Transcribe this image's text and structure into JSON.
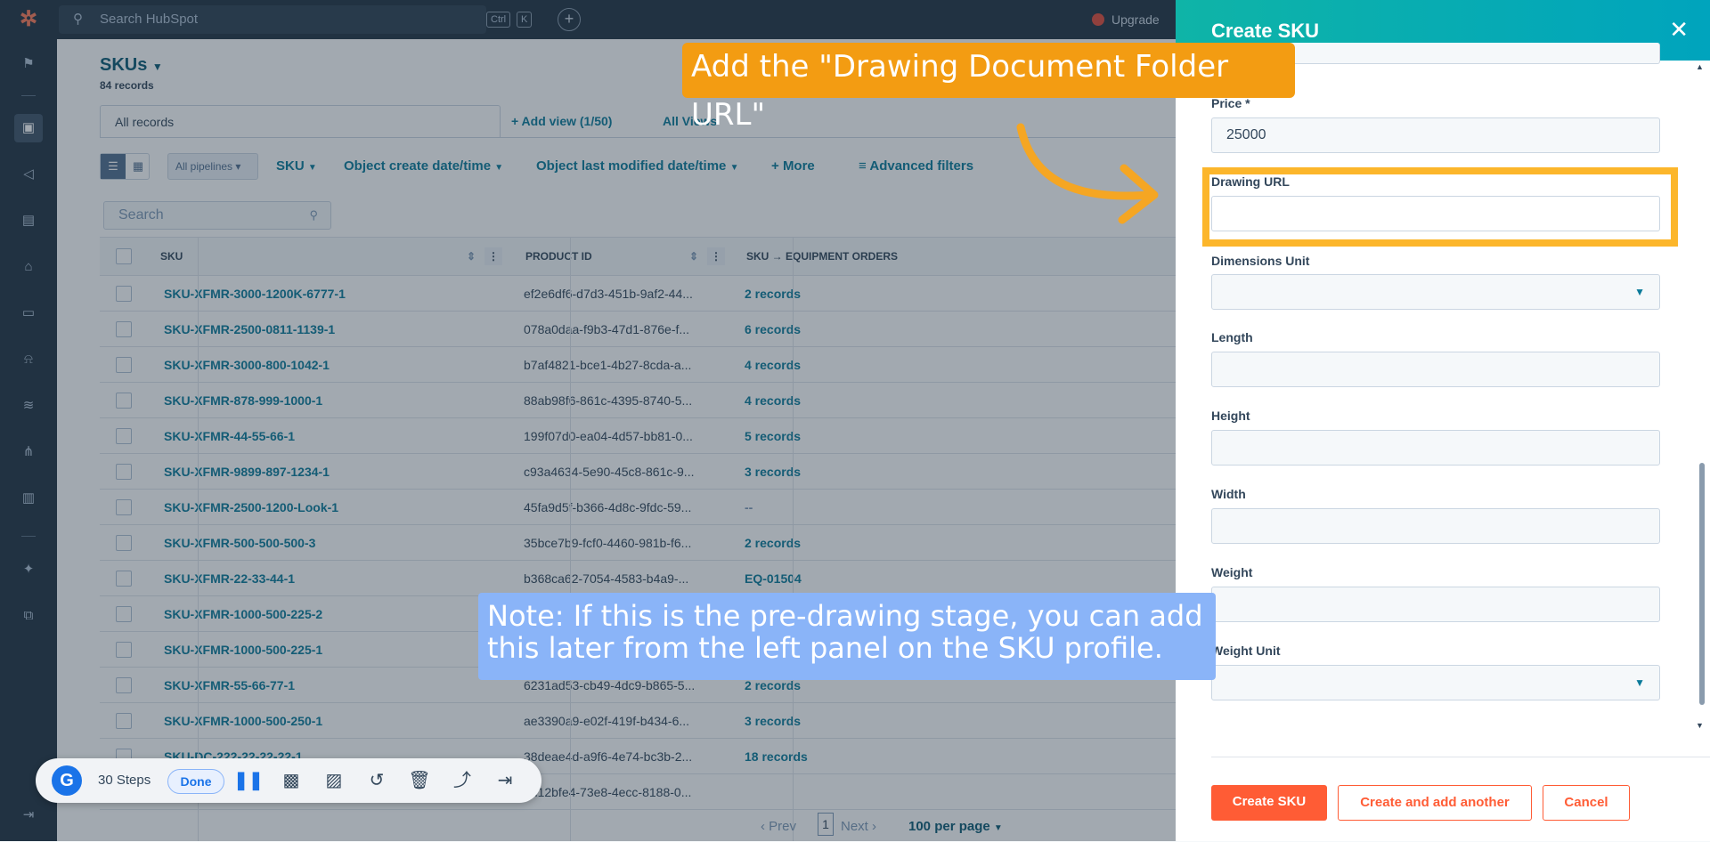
{
  "topbar": {
    "search_placeholder": "Search HubSpot",
    "kbd_ctrl": "Ctrl",
    "kbd_k": "K",
    "upgrade_label": "Upgrade"
  },
  "page": {
    "title": "SKUs",
    "records_count": "84 records"
  },
  "tabs": {
    "all_records": "All records",
    "add_view": "Add view (1/50)",
    "all_views": "All Views"
  },
  "filters": {
    "pipelines": "All pipelines",
    "sku": "SKU",
    "create_date": "Object create date/time",
    "modified_date": "Object last modified date/time",
    "more": "More",
    "advanced": "Advanced filters"
  },
  "table": {
    "search_placeholder": "Search",
    "columns": [
      "SKU",
      "PRODUCT ID",
      "SKU → EQUIPMENT ORDERS"
    ],
    "rows": [
      {
        "sku": "SKU-XFMR-3000-1200K-6777-1",
        "pid": "ef2e6df6-d7d3-451b-9af2-44...",
        "eq": "2 records"
      },
      {
        "sku": "SKU-XFMR-2500-0811-1139-1",
        "pid": "078a0daa-f9b3-47d1-876e-f...",
        "eq": "6 records"
      },
      {
        "sku": "SKU-XFMR-3000-800-1042-1",
        "pid": "b7af4821-bce1-4b27-8cda-a...",
        "eq": "4 records"
      },
      {
        "sku": "SKU-XFMR-878-999-1000-1",
        "pid": "88ab98f6-861c-4395-8740-5...",
        "eq": "4 records"
      },
      {
        "sku": "SKU-XFMR-44-55-66-1",
        "pid": "199f07d0-ea04-4d57-bb81-0...",
        "eq": "5 records"
      },
      {
        "sku": "SKU-XFMR-9899-897-1234-1",
        "pid": "c93a4634-5e90-45c8-861c-9...",
        "eq": "3 records"
      },
      {
        "sku": "SKU-XFMR-2500-1200-Look-1",
        "pid": "45fa9d5f-b366-4d8c-9fdc-59...",
        "eq": "--"
      },
      {
        "sku": "SKU-XFMR-500-500-500-3",
        "pid": "35bce7b9-fcf0-4460-981b-f6...",
        "eq": "2 records"
      },
      {
        "sku": "SKU-XFMR-22-33-44-1",
        "pid": "b368ca62-7054-4583-b4a9-...",
        "eq": "EQ-01504"
      },
      {
        "sku": "SKU-XFMR-1000-500-225-2",
        "pid": "",
        "eq": ""
      },
      {
        "sku": "SKU-XFMR-1000-500-225-1",
        "pid": "",
        "eq": ""
      },
      {
        "sku": "SKU-XFMR-55-66-77-1",
        "pid": "6231ad53-cb49-4dc9-b865-5...",
        "eq": "2 records"
      },
      {
        "sku": "SKU-XFMR-1000-500-250-1",
        "pid": "ae3390a9-e02f-419f-b434-6...",
        "eq": "3 records"
      },
      {
        "sku": "SKU-DC-222-22-22-22-1",
        "pid": "38deae4d-a9f6-4e74-bc3b-2...",
        "eq": "18 records"
      },
      {
        "sku": "",
        "pid": "ed12bfe4-73e8-4ecc-8188-0...",
        "eq": ""
      }
    ]
  },
  "pager": {
    "prev": "Prev",
    "page": "1",
    "next": "Next",
    "per_page": "100 per page"
  },
  "recorder": {
    "logo": "G",
    "steps": "30 Steps",
    "done": "Done"
  },
  "panel": {
    "title": "Create SKU",
    "price_label": "Price *",
    "price_value": "25000",
    "drawing_label": "Drawing URL",
    "drawing_value": "",
    "dim_unit_label": "Dimensions Unit",
    "length_label": "Length",
    "height_label": "Height",
    "width_label": "Width",
    "weight_label": "Weight",
    "weight_unit_label": "Weight Unit",
    "create_btn": "Create SKU",
    "create_another_btn": "Create and add another",
    "cancel_btn": "Cancel"
  },
  "annotations": {
    "callout_top": "Add the \"Drawing Document Folder URL\"",
    "callout_note": "Note: If this is the pre-drawing stage, you can add this later from the left panel on the SKU profile."
  },
  "colors": {
    "accent": "#0b7a9a",
    "panel_header": "#00a4bd",
    "highlight": "#fcb62b",
    "callout_orange": "#f39c12",
    "callout_blue": "#8ab4f8",
    "primary_button": "#ff5c35"
  }
}
